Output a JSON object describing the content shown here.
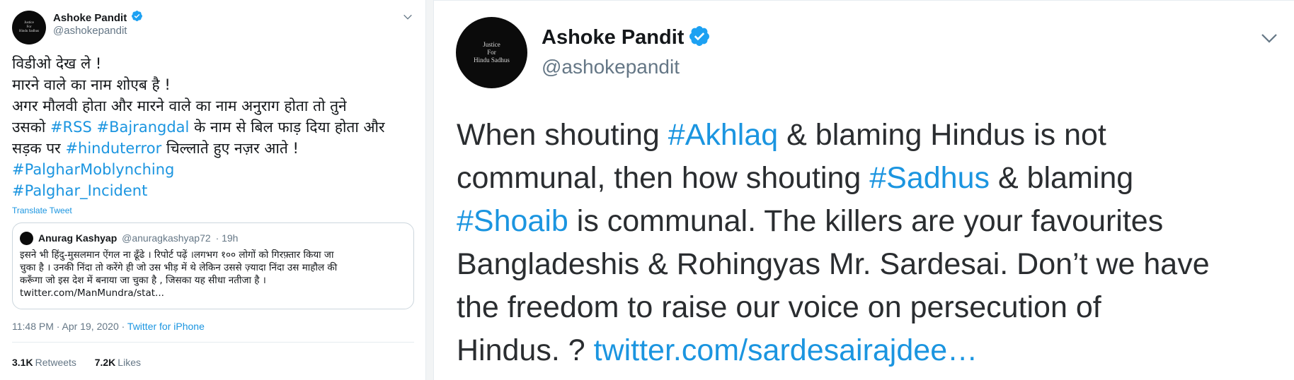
{
  "left_tweet": {
    "author": {
      "display_name": "Ashoke Pandit",
      "handle": "@ashokepandit",
      "avatar_text": [
        "Justice",
        "For",
        "Hindu Sadhus"
      ]
    },
    "text_lines": [
      [
        {
          "t": "विडीओ देख ले !"
        }
      ],
      [
        {
          "t": "मारने वाले का नाम शोएब है !"
        }
      ],
      [
        {
          "t": "अगर मौलवी होता और मारने वाले का नाम अनुराग होता तो तुने"
        }
      ],
      [
        {
          "t": "उसको "
        },
        {
          "t": "#RSS",
          "h": true
        },
        {
          "t": " "
        },
        {
          "t": "#Bajrangdal",
          "h": true
        },
        {
          "t": " के नाम से बिल फाड़ दिया होता और"
        }
      ],
      [
        {
          "t": "सड़क पर "
        },
        {
          "t": "#hinduterror",
          "h": true
        },
        {
          "t": " चिल्लाते हुए नज़र आते !"
        }
      ],
      [
        {
          "t": "#PalgharMoblynching",
          "h": true
        }
      ],
      [
        {
          "t": "#Palghar_Incident",
          "h": true
        }
      ]
    ],
    "translate_label": "Translate Tweet",
    "quoted_tweet": {
      "display_name": "Anurag Kashyap",
      "handle": "@anuragkashyap72",
      "time": "· 19h",
      "body_lines": [
        "इसने भी हिंदु-मुसलमान ऐंगल ना ढूँढे । रिपोर्ट पढ़ें ।लगभग  १०० लोगों को गिरफ़्तार किया जा",
        "चुका है । उनकी निंदा तो करेंगे ही जो उस भीड़ में थे लेकिन उससे ज़्यादा निंदा उस माहौल की",
        "करूँगा जो इस देश में बनाया जा चुका है , जिसका यह सीधा नतीजा है ।",
        "twitter.com/ManMundra/stat..."
      ]
    },
    "timestamp": "11:48 PM · Apr 19, 2020 · ",
    "source": "Twitter for iPhone",
    "stats": {
      "retweets_count": "3.1K",
      "retweets_label": "Retweets",
      "likes_count": "7.2K",
      "likes_label": "Likes"
    }
  },
  "right_tweet": {
    "author": {
      "display_name": "Ashoke Pandit",
      "handle": "@ashokepandit",
      "avatar_text": [
        "Justice",
        "For",
        "Hindu Sadhus"
      ]
    },
    "text_lines": [
      [
        {
          "t": "When shouting "
        },
        {
          "t": "#Akhlaq",
          "h": true
        },
        {
          "t": "  & blaming Hindus is not"
        }
      ],
      [
        {
          "t": "communal, then how shouting  "
        },
        {
          "t": "#Sadhus",
          "h": true
        },
        {
          "t": " & blaming"
        }
      ],
      [
        {
          "t": "#Shoaib",
          "h": true
        },
        {
          "t": " is communal. The killers are your favourites"
        }
      ],
      [
        {
          "t": "Bangladeshis & Rohingyas Mr. Sardesai. Don’t we have"
        }
      ],
      [
        {
          "t": "the freedom to raise our voice on persecution of"
        }
      ],
      [
        {
          "t": "Hindus. ? "
        },
        {
          "t": "twitter.com/sardesairajdee…",
          "h": true
        }
      ]
    ]
  },
  "colors": {
    "link": "#1b95e0",
    "verified": "#1da1f2",
    "muted": "#657786",
    "text": "#14171a",
    "border": "#e6ecf0"
  },
  "icons": [
    "verified-badge-icon",
    "chevron-down-icon"
  ]
}
